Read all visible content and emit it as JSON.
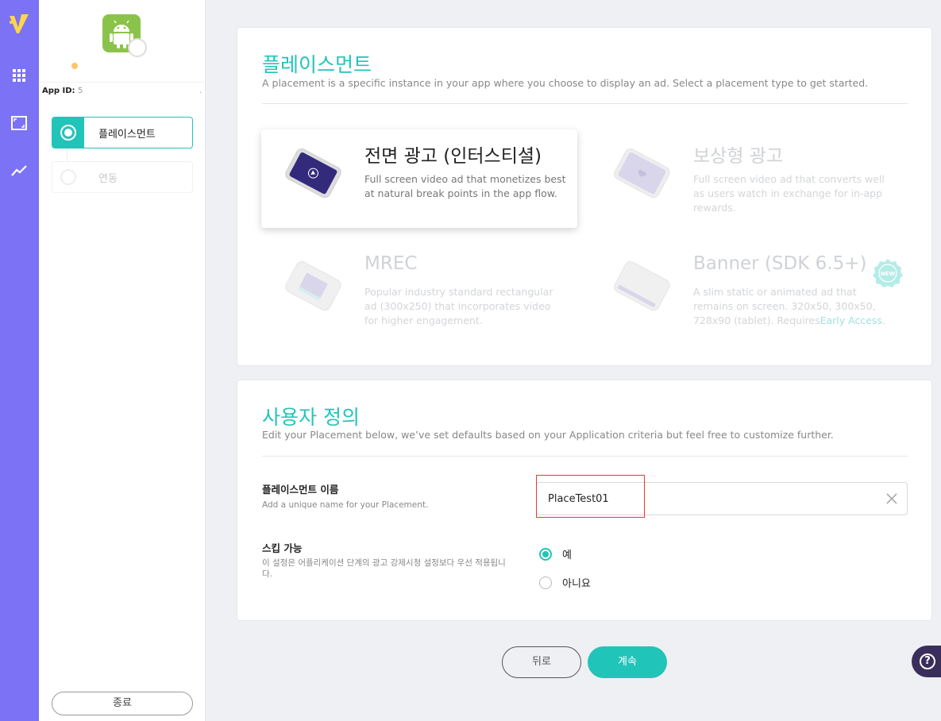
{
  "colors": {
    "rail": "#7b72f5",
    "accent": "#21c4b8",
    "focus_outline": "#e53935",
    "help_bg": "#3a2e5c"
  },
  "rail": {
    "icons": [
      "vungle-logo",
      "grid-icon",
      "placement-frame-icon",
      "trend-icon"
    ]
  },
  "sidebar": {
    "app_id_label": "App ID:",
    "app_id_value": "5",
    "app_id_tail": ".",
    "steps": [
      {
        "label": "플레이스먼트",
        "state": "active"
      },
      {
        "label": "연동",
        "state": "disabled"
      }
    ],
    "exit_label": "종료"
  },
  "placement_section": {
    "title": "플레이스먼트",
    "description": "A placement is a specific instance in your app where you choose to display an ad. Select a placement type to get started.",
    "types": [
      {
        "title": "전면 광고 (인터스티셜)",
        "description": "Full screen video ad that monetizes best at natural break points in the app flow.",
        "selected": true
      },
      {
        "title": "보상형 광고",
        "description": "Full screen video ad that converts well as users watch in exchange for in-app rewards.",
        "selected": false
      },
      {
        "title": "MREC",
        "description": "Popular industry standard rectangular ad (300x250) that incorporates video for higher engagement.",
        "selected": false
      },
      {
        "title": "Banner (SDK 6.5+)",
        "description": "A slim static or animated ad that remains on screen. 320x50, 300x50, 728x90 (tablet). Requires",
        "link": "Early Access",
        "link_suffix": ".",
        "badge": "NEW",
        "selected": false
      }
    ]
  },
  "custom_section": {
    "title": "사용자 정의",
    "description": "Edit your Placement below, we’ve set defaults based on your Application criteria but feel free to customize further.",
    "name_label": "플레이스먼트 이름",
    "name_help": "Add a unique name for your Placement.",
    "name_value": "PlaceTest01",
    "skip_label": "스킵 가능",
    "skip_help": "이 설정은 어플리케이션 단계의 광고 강제시청 설정보다 우선 적용됩니다.",
    "skip_options": [
      {
        "label": "예",
        "selected": true
      },
      {
        "label": "아니요",
        "selected": false
      }
    ]
  },
  "footer": {
    "back_label": "뒤로",
    "next_label": "계속",
    "help_glyph": "?"
  }
}
